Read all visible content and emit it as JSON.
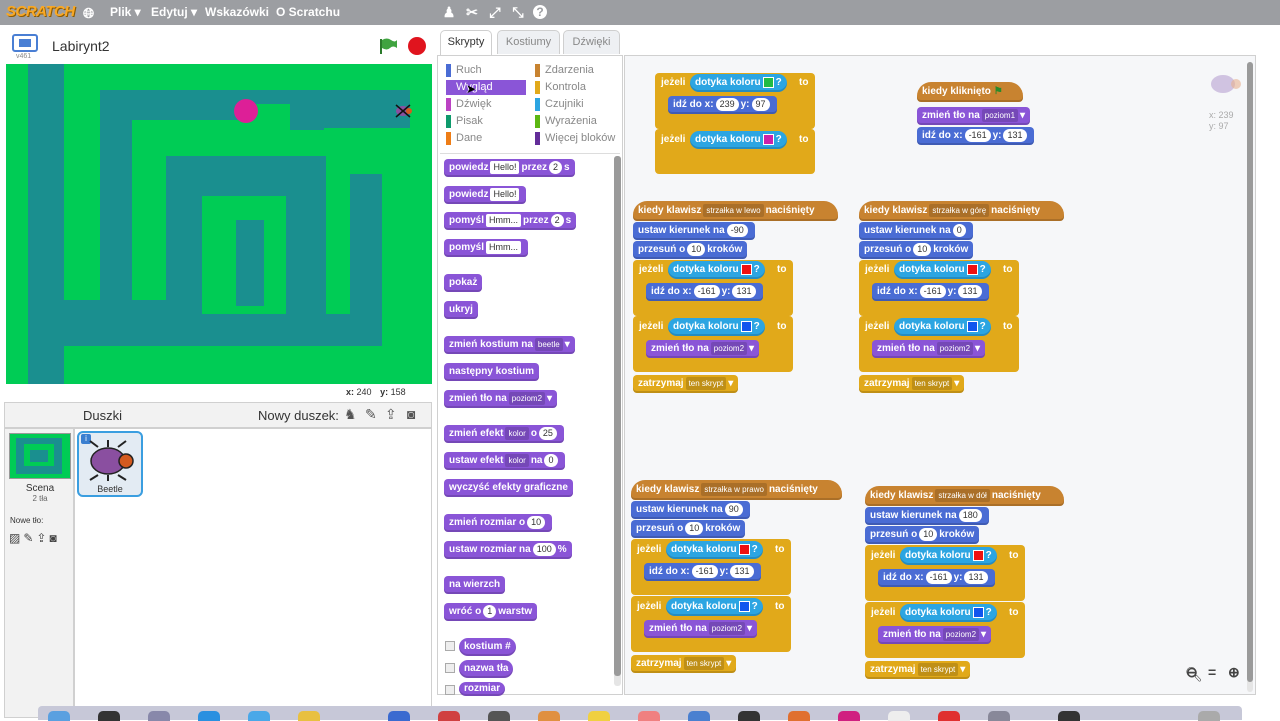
{
  "menubar": {
    "logo": "SCRATCH",
    "menus": [
      "Plik ▾",
      "Edytuj ▾",
      "Wskazówki",
      "O Scratchu"
    ]
  },
  "stage": {
    "project_title": "Labirynt2",
    "version": "v461",
    "x_label": "x:",
    "x_value": "240",
    "y_label": "y:",
    "y_value": "158"
  },
  "sprites": {
    "header": "Duszki",
    "new_sprite_label": "Nowy duszek:",
    "scene_label": "Scena",
    "scene_count": "2 tła",
    "new_background_label": "Nowe tło:",
    "sprite_name": "Beetle"
  },
  "tabs": [
    "Skrypty",
    "Kostiumy",
    "Dźwięki"
  ],
  "categories": [
    {
      "label": "Ruch",
      "color": "#4a6cd4"
    },
    {
      "label": "Wygląd",
      "color": "#8a55d7"
    },
    {
      "label": "Dźwięk",
      "color": "#bb42c3"
    },
    {
      "label": "Pisak",
      "color": "#0e9a6c"
    },
    {
      "label": "Dane",
      "color": "#ee7d16"
    },
    {
      "label": "Zdarzenia",
      "color": "#c88330"
    },
    {
      "label": "Kontrola",
      "color": "#e1a91a"
    },
    {
      "label": "Czujniki",
      "color": "#2ca5e2"
    },
    {
      "label": "Wyrażenia",
      "color": "#5cb712"
    },
    {
      "label": "Więcej bloków",
      "color": "#632d99"
    }
  ],
  "palette": {
    "say_for": [
      "powiedz",
      "Hello!",
      "przez",
      "2",
      "s"
    ],
    "say": [
      "powiedz",
      "Hello!"
    ],
    "think_for": [
      "pomyśl",
      "Hmm...",
      "przez",
      "2",
      "s"
    ],
    "think": [
      "pomyśl",
      "Hmm..."
    ],
    "show": "pokaż",
    "hide": "ukryj",
    "switch_costume": [
      "zmień kostium na",
      "beetle"
    ],
    "next_costume": "następny kostium",
    "switch_backdrop": [
      "zmień tło na",
      "poziom2"
    ],
    "change_effect": [
      "zmień efekt",
      "kolor",
      "o",
      "25"
    ],
    "set_effect": [
      "ustaw efekt",
      "kolor",
      "na",
      "0"
    ],
    "clear_effects": "wyczyść efekty graficzne",
    "change_size": [
      "zmień rozmiar o",
      "10"
    ],
    "set_size": [
      "ustaw rozmiar na",
      "100",
      "%"
    ],
    "go_front": "na wierzch",
    "go_back": [
      "wróć o",
      "1",
      "warstw"
    ],
    "costume_rep": "kostium #",
    "backdrop_name": "nazwa tła",
    "size_rep": "rozmiar"
  },
  "script": {
    "when_key": "kiedy klawisz",
    "pressed": "naciśnięty",
    "if": "jeżeli",
    "touching_color": "dotyka koloru",
    "q": "?",
    "to": "to",
    "goto_x": "idź do x:",
    "y": "y:",
    "point_dir": "ustaw kierunek na",
    "move": "przesuń o",
    "steps": "kroków",
    "switch_backdrop": "zmień tło na",
    "stop": "zatrzymaj",
    "this_script": "ten skrypt",
    "when_flag": "kiedy kliknięto",
    "key_left": "strzałka w lewo",
    "key_up": "strzałka w górę",
    "key_right": "strzałka w prawo",
    "key_down": "strzałka w dół",
    "dir_left": "-90",
    "dir_up": "0",
    "dir_right": "90",
    "dir_down": "180",
    "steps_val": "10",
    "start_x": "-161",
    "start_y": "131",
    "goal_x": "239",
    "goal_y": "97",
    "level1": "poziom1",
    "level2": "poziom2",
    "coord_x": "x: 239",
    "coord_y": "y: 97"
  },
  "colors": {
    "wall": "#ee1111",
    "exit": "#1155ee",
    "goal_green": "#22bb44",
    "goal_pink": "#cc22aa"
  }
}
